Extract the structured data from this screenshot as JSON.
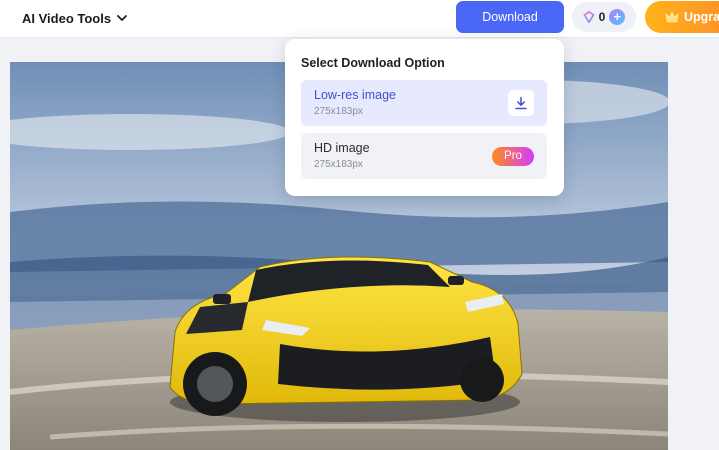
{
  "topbar": {
    "tools_menu_label": "AI Video Tools",
    "download_label": "Download",
    "credits_count": "0",
    "upgrade_label": "Upgra"
  },
  "dropdown": {
    "title": "Select Download Option",
    "options": [
      {
        "label": "Low-res image",
        "size": "275x183px",
        "action_icon": "download-icon"
      },
      {
        "label": "HD image",
        "size": "275x183px",
        "badge": "Pro"
      }
    ]
  },
  "canvas": {
    "image_subject": "yellow sports car on race track"
  },
  "colors": {
    "primary": "#4b67f5",
    "upgrade_gradient_start": "#ffb21a",
    "upgrade_gradient_end": "#ff8a2a",
    "pro_gradient_start": "#ff8c1a",
    "pro_gradient_end": "#d23cff",
    "selected_option_bg": "#e7eaff"
  }
}
